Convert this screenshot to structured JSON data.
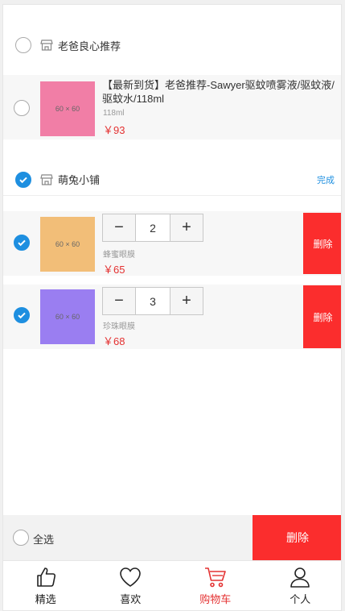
{
  "shops": [
    {
      "name": "老爸良心推荐",
      "items": [
        {
          "thumb_text": "60 × 60",
          "thumb_color": "#f17ea6",
          "title": "【最新到货】老爸推荐-Sawyer驱蚊喷雾液/驱蚊液/驱蚊水/118ml",
          "spec": "118ml",
          "price": "￥93"
        }
      ]
    },
    {
      "name": "萌兔小铺",
      "done_label": "完成",
      "items": [
        {
          "thumb_text": "60 × 60",
          "thumb_color": "#f2be78",
          "quantity": "2",
          "spec": "蜂蜜眼膜",
          "price": "￥65",
          "delete_label": "删除"
        },
        {
          "thumb_text": "60 × 60",
          "thumb_color": "#9a7ef1",
          "quantity": "3",
          "spec": "珍珠眼膜",
          "price": "￥68",
          "delete_label": "删除"
        }
      ]
    }
  ],
  "stepper": {
    "minus": "−",
    "plus": "+"
  },
  "footer": {
    "select_all": "全选",
    "delete_label": "删除"
  },
  "tabbar": [
    {
      "label": "精选",
      "icon": "thumbs-up-icon"
    },
    {
      "label": "喜欢",
      "icon": "heart-icon"
    },
    {
      "label": "购物车",
      "icon": "cart-icon",
      "active": true
    },
    {
      "label": "个人",
      "icon": "person-icon"
    }
  ],
  "colors": {
    "accent": "#1e8fe0",
    "danger": "#fb2d2d",
    "price": "#e43232"
  }
}
